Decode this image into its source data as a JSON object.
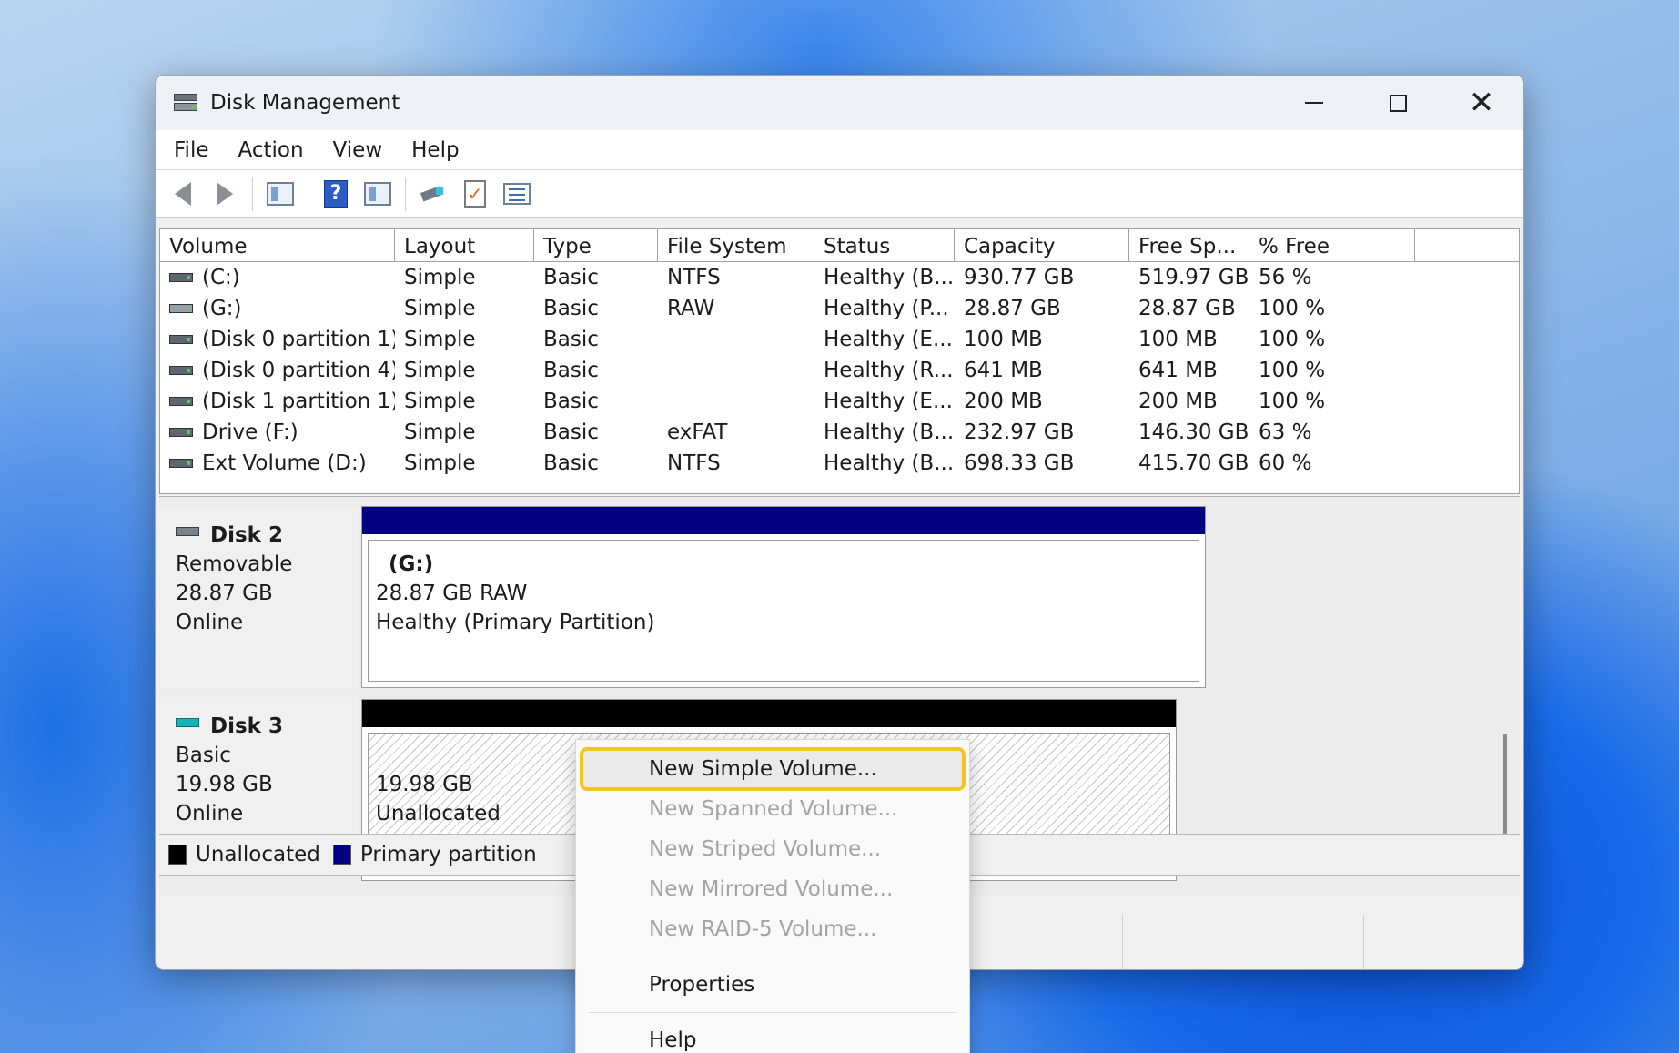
{
  "window": {
    "title": "Disk Management"
  },
  "menu": [
    "File",
    "Action",
    "View",
    "Help"
  ],
  "table": {
    "columns": [
      "Volume",
      "Layout",
      "Type",
      "File System",
      "Status",
      "Capacity",
      "Free Sp...",
      "% Free"
    ],
    "rows": [
      [
        "(C:)",
        "Simple",
        "Basic",
        "NTFS",
        "Healthy (B...",
        "930.77 GB",
        "519.97 GB",
        "56 %"
      ],
      [
        "(G:)",
        "Simple",
        "Basic",
        "RAW",
        "Healthy (P...",
        "28.87 GB",
        "28.87 GB",
        "100 %"
      ],
      [
        "(Disk 0 partition 1)",
        "Simple",
        "Basic",
        "",
        "Healthy (E...",
        "100 MB",
        "100 MB",
        "100 %"
      ],
      [
        "(Disk 0 partition 4)",
        "Simple",
        "Basic",
        "",
        "Healthy (R...",
        "641 MB",
        "641 MB",
        "100 %"
      ],
      [
        "(Disk 1 partition 1)",
        "Simple",
        "Basic",
        "",
        "Healthy (E...",
        "200 MB",
        "200 MB",
        "100 %"
      ],
      [
        "Drive (F:)",
        "Simple",
        "Basic",
        "exFAT",
        "Healthy (B...",
        "232.97 GB",
        "146.30 GB",
        "63 %"
      ],
      [
        "Ext Volume (D:)",
        "Simple",
        "Basic",
        "NTFS",
        "Healthy (B...",
        "698.33 GB",
        "415.70 GB",
        "60 %"
      ]
    ]
  },
  "disks": {
    "disk2": {
      "name": "Disk 2",
      "kind": "Removable",
      "size": "28.87 GB",
      "state": "Online",
      "partition": {
        "label": "(G:)",
        "line1": "28.87 GB RAW",
        "line2": "Healthy (Primary Partition)"
      },
      "header_color": "#000080"
    },
    "disk3": {
      "name": "Disk 3",
      "kind": "Basic",
      "size": "19.98 GB",
      "state": "Online",
      "partition": {
        "line1": "19.98 GB",
        "line2": "Unallocated"
      },
      "header_color": "#000000"
    }
  },
  "legend": [
    {
      "label": "Unallocated",
      "color": "#000000"
    },
    {
      "label": "Primary partition",
      "color": "#000080"
    }
  ],
  "context_menu": {
    "items": [
      {
        "label": "New Simple Volume...",
        "enabled": true,
        "highlighted": true
      },
      {
        "label": "New Spanned Volume...",
        "enabled": false
      },
      {
        "label": "New Striped Volume...",
        "enabled": false
      },
      {
        "label": "New Mirrored Volume...",
        "enabled": false
      },
      {
        "label": "New RAID-5 Volume...",
        "enabled": false
      }
    ],
    "properties": "Properties",
    "help": "Help"
  },
  "highlight_color": "#f3c623"
}
